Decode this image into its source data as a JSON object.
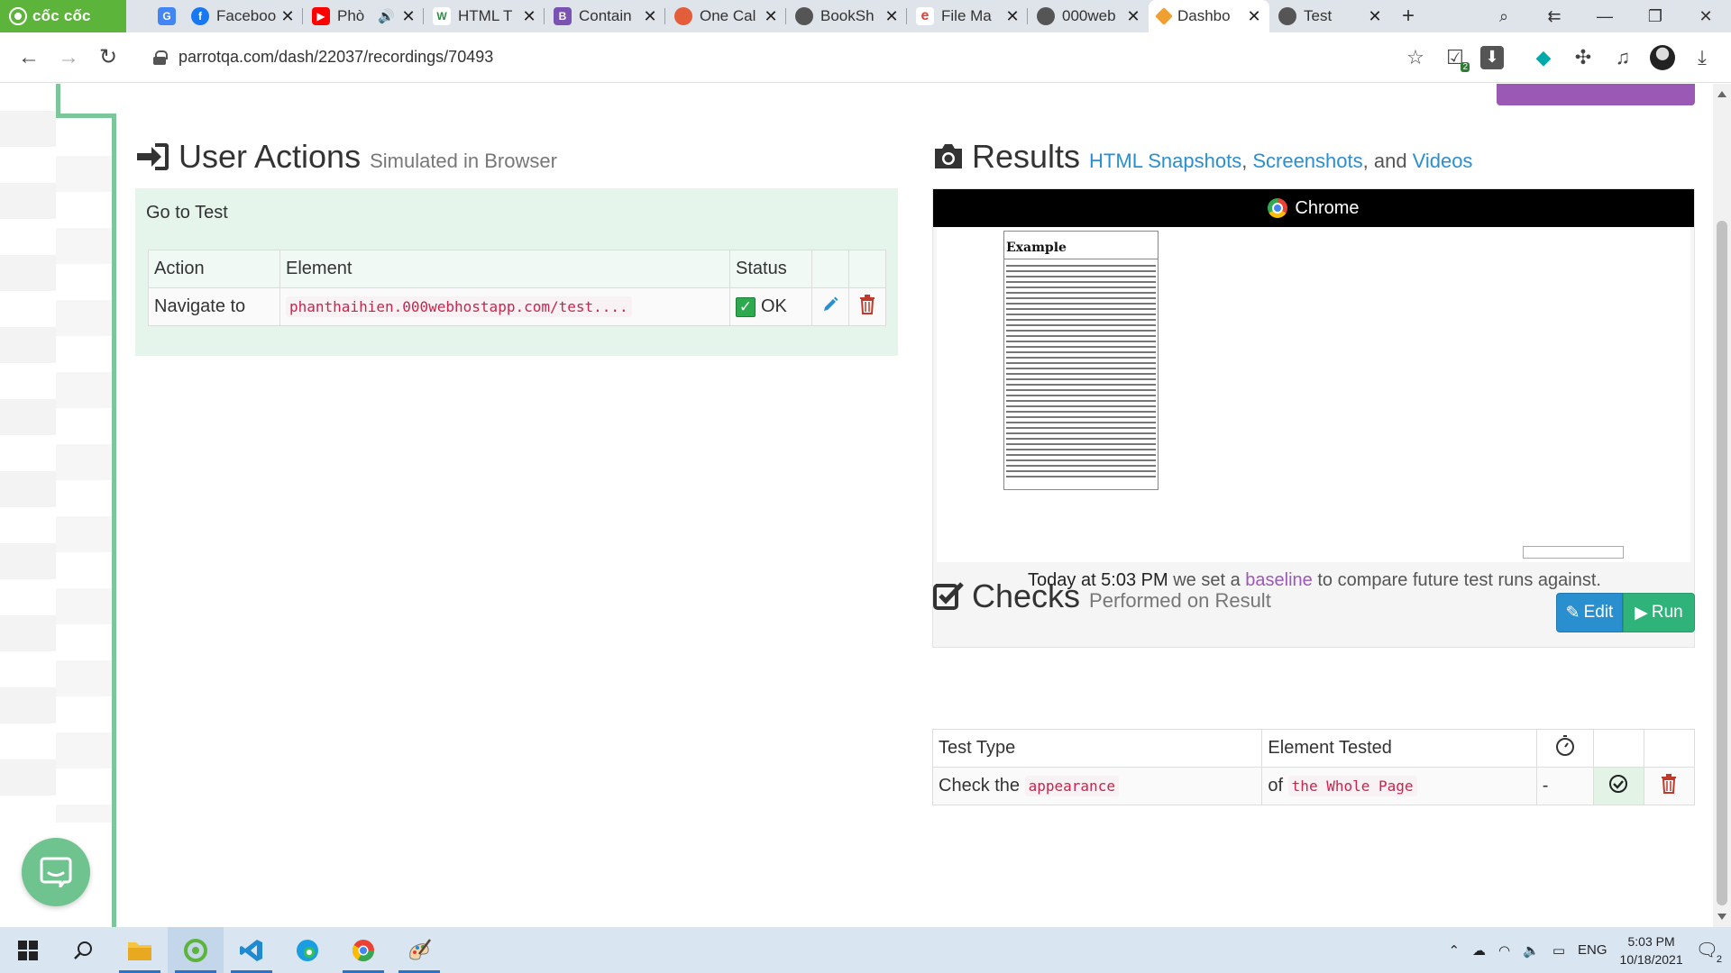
{
  "browser": {
    "brand": "cốc cốc",
    "tabs": [
      {
        "title": "Faceboo",
        "color": "#1877f2",
        "glyph": "f"
      },
      {
        "title": "Phò",
        "color": "#ff0000",
        "glyph": "▶"
      },
      {
        "title": "HTML T",
        "color": "#2f8d46",
        "glyph": "W"
      },
      {
        "title": "Contain",
        "color": "#7952b3",
        "glyph": "B"
      },
      {
        "title": "One Cal",
        "color": "#e35d3a",
        "glyph": "●"
      },
      {
        "title": "BookSh",
        "color": "#555555",
        "glyph": "◍"
      },
      {
        "title": "File Ma",
        "color": "#e0413a",
        "glyph": "e"
      },
      {
        "title": "000web",
        "color": "#555555",
        "glyph": "◍"
      },
      {
        "title": "Dashbo",
        "color": "#f0a030",
        "glyph": "◆"
      },
      {
        "title": "Test",
        "color": "#555555",
        "glyph": "◍"
      }
    ],
    "url": "parrotqa.com/dash/22037/recordings/70493",
    "extension_badge": "2"
  },
  "user_actions": {
    "title": "User Actions",
    "subtitle": "Simulated in Browser",
    "step_title": "Go to Test",
    "columns": [
      "Action",
      "Element",
      "Status"
    ],
    "rows": [
      {
        "action": "Navigate to",
        "element": "phanthaihien.000webhostapp.com/test....",
        "status": "OK"
      }
    ]
  },
  "results": {
    "title": "Results",
    "link1": "HTML Snapshots",
    "sep1": ",",
    "link2": "Screenshots",
    "sep2": ", and",
    "link3": "Videos",
    "browser_label": "Chrome",
    "snapshot_heading": "Example",
    "baseline_time": "Today at 5:03 PM",
    "baseline_pre": "we set a",
    "baseline_link": "baseline",
    "baseline_post": "to compare future test runs against."
  },
  "checks": {
    "title": "Checks",
    "subtitle": "Performed on Result",
    "edit_label": "Edit",
    "run_label": "Run",
    "columns": [
      "Test Type",
      "Element Tested"
    ],
    "row": {
      "type_prefix": "Check the",
      "type_code": "appearance",
      "element_prefix": "of",
      "element_code": "the Whole Page",
      "timer": "-"
    }
  },
  "taskbar": {
    "time": "5:03 PM",
    "date": "10/18/2021",
    "lang": "ENG",
    "notifications": "2"
  },
  "colors": {
    "accent_green": "#7cc79a",
    "link_blue": "#2a8fcf",
    "baseline_purple": "#9b59b6",
    "code_red": "#c7254e",
    "run_green": "#2fb37a"
  }
}
